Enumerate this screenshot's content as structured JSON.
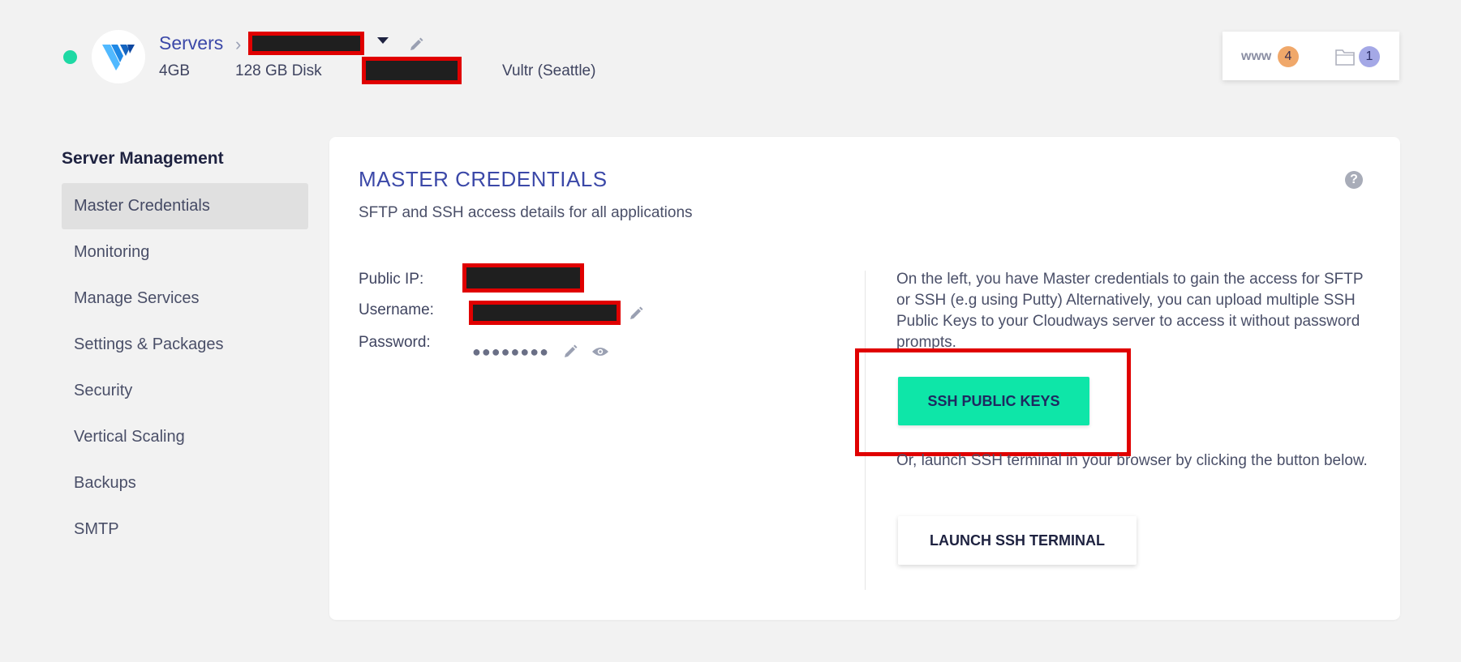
{
  "header": {
    "breadcrumb_root": "Servers",
    "server_name": "",
    "ram": "4GB",
    "disk": "128 GB Disk",
    "ip": "",
    "provider": "Vultr (Seattle)",
    "status_color": "#1ed9a4",
    "www_label": "www",
    "www_count": "4",
    "folder_count": "1"
  },
  "sidebar": {
    "title": "Server Management",
    "items": [
      {
        "label": "Master Credentials"
      },
      {
        "label": "Monitoring"
      },
      {
        "label": "Manage Services"
      },
      {
        "label": "Settings & Packages"
      },
      {
        "label": "Security"
      },
      {
        "label": "Vertical Scaling"
      },
      {
        "label": "Backups"
      },
      {
        "label": "SMTP"
      }
    ]
  },
  "main": {
    "title": "MASTER CREDENTIALS",
    "subtitle": "SFTP and SSH access details for all applications",
    "help_icon": "?",
    "public_ip_label": "Public IP:",
    "username_label": "Username:",
    "password_label": "Password:",
    "password_mask": "●●●●●●●●",
    "info_text": "On the left, you have Master credentials to gain the access for SFTP or SSH (e.g using Putty) Alternatively, you can upload multiple SSH Public Keys to your Cloudways server to access it without password prompts.",
    "ssh_keys_button": "SSH PUBLIC KEYS",
    "or_text": "Or, launch SSH terminal in your browser by clicking the button below.",
    "launch_button": "LAUNCH SSH TERMINAL",
    "accent_color": "#0ee6a8",
    "title_color": "#3b48a8"
  }
}
